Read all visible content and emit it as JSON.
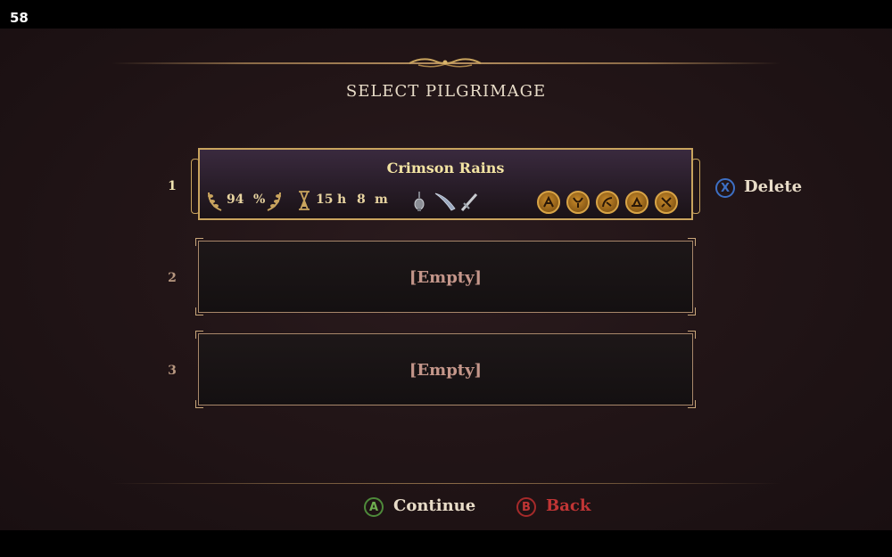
{
  "fps": "58",
  "screen": {
    "title": "SELECT PILGRIMAGE"
  },
  "slots": [
    {
      "number": "1",
      "name": "Crimson Rains",
      "completion": "94",
      "completion_unit": "%",
      "time_hours": "15",
      "time_hours_unit": "h",
      "time_minutes": "8",
      "time_minutes_unit": "m",
      "equipment_icons": [
        "censer-icon",
        "blade-icon",
        "sword-icon"
      ],
      "relic_icons": [
        "relic-icon-1",
        "relic-icon-2",
        "relic-icon-3",
        "relic-icon-4",
        "relic-icon-5"
      ]
    },
    {
      "number": "2",
      "label": "[Empty]"
    },
    {
      "number": "3",
      "label": "[Empty]"
    }
  ],
  "actions": {
    "delete": {
      "button": "X",
      "label": "Delete"
    },
    "continue": {
      "button": "A",
      "label": "Continue"
    },
    "back": {
      "button": "B",
      "label": "Back"
    }
  },
  "colors": {
    "accent_gold": "#c9a45e",
    "delete_blue": "#3d6fc4",
    "continue_green": "#6fae4f",
    "back_red": "#c13535"
  }
}
